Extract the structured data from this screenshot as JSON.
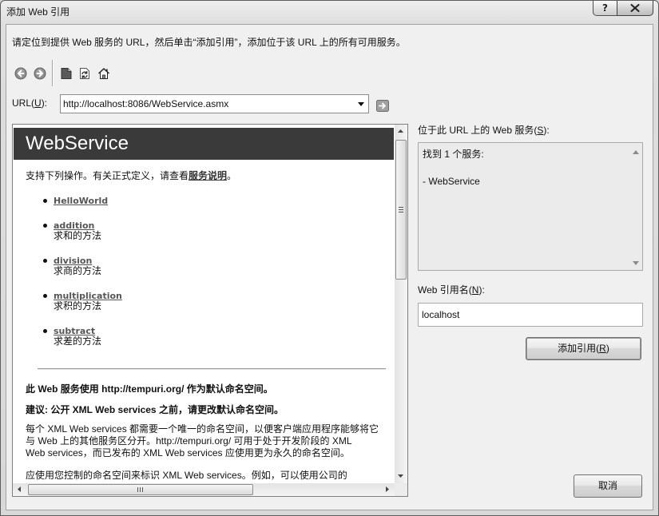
{
  "window": {
    "title": "添加 Web 引用",
    "help_label": "?"
  },
  "instruction": "请定位到提供 Web 服务的 URL，然后单击“添加引用”，添加位于该 URL 上的所有可用服务。",
  "url": {
    "label_prefix": "URL(",
    "label_key": "U",
    "label_suffix": "):",
    "value": "http://localhost:8086/WebService.asmx"
  },
  "browser": {
    "heading": "WebService",
    "intro_before": "支持下列操作。有关正式定义，请查看",
    "intro_link": "服务说明",
    "intro_after": "。",
    "operations": [
      {
        "name": "HelloWorld"
      },
      {
        "name": "addition",
        "desc": "求和的方法"
      },
      {
        "name": "division",
        "desc": "求商的方法"
      },
      {
        "name": "multiplication",
        "desc": "求积的方法"
      },
      {
        "name": "subtract",
        "desc": "求差的方法"
      }
    ],
    "namespace_notice": "此 Web 服务使用 http://tempuri.org/ 作为默认命名空间。",
    "recommendation": "建议: 公开 XML Web services 之前，请更改默认命名空间。",
    "paragraph1_lines": [
      "每个 XML Web services 都需要一个唯一的命名空间，以便客户端应用程序能够将它",
      "与 Web 上的其他服务区分开。http://tempuri.org/ 可用于处于开发阶段的 XML",
      "Web services，而已发布的 XML Web services 应使用更为永久的命名空间。"
    ],
    "paragraph2": "应使用您控制的命名空间来标识 XML Web services。例如，可以使用公司的"
  },
  "services_panel": {
    "label_prefix": "位于此 URL 上的 Web 服务(",
    "label_key": "S",
    "label_suffix": "):",
    "lines": [
      "找到 1 个服务:",
      "- WebService"
    ]
  },
  "reference_name": {
    "label_prefix": "Web 引用名(",
    "label_key": "N",
    "label_suffix": "):",
    "value": "localhost"
  },
  "buttons": {
    "add_label_prefix": "添加引用(",
    "add_label_key": "R",
    "add_label_suffix": ")",
    "cancel_label": "取消"
  },
  "icons": {
    "close": "close-icon",
    "back": "back-icon",
    "forward": "forward-icon",
    "stop": "stop-icon",
    "refresh": "refresh-icon",
    "home": "home-icon",
    "dropdown": "chevron-down-icon",
    "go": "go-icon"
  },
  "colors": {
    "dialog_bg": "#f0f0f0",
    "header_bg": "#3a3a3a",
    "header_text": "#ffffff",
    "link": "#555555"
  }
}
